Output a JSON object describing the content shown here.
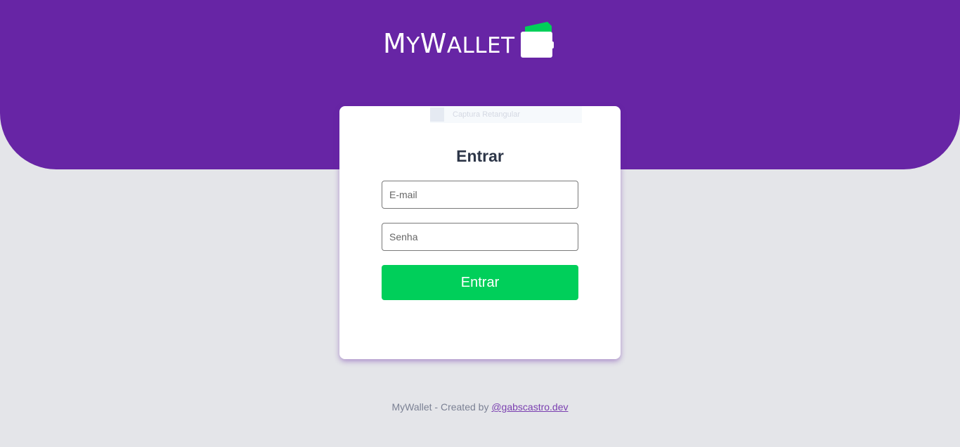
{
  "brand": {
    "name_part1_cap": "M",
    "name_part1_rest": "Y",
    "name_part2_cap": "W",
    "name_part2_rest": "ALLET",
    "icon": "wallet-icon"
  },
  "overlay": {
    "text": "Captura Retangular"
  },
  "login": {
    "title": "Entrar",
    "email_placeholder": "E-mail",
    "password_placeholder": "Senha",
    "submit_label": "Entrar"
  },
  "footer": {
    "text": "MyWallet - Created by ",
    "link_label": "@gabscastro.dev"
  },
  "colors": {
    "header_purple": "#6725a5",
    "page_background": "#e4e5e9",
    "button_green": "#00cf5a",
    "card_background": "#ffffff",
    "title_text": "#2d3648"
  }
}
